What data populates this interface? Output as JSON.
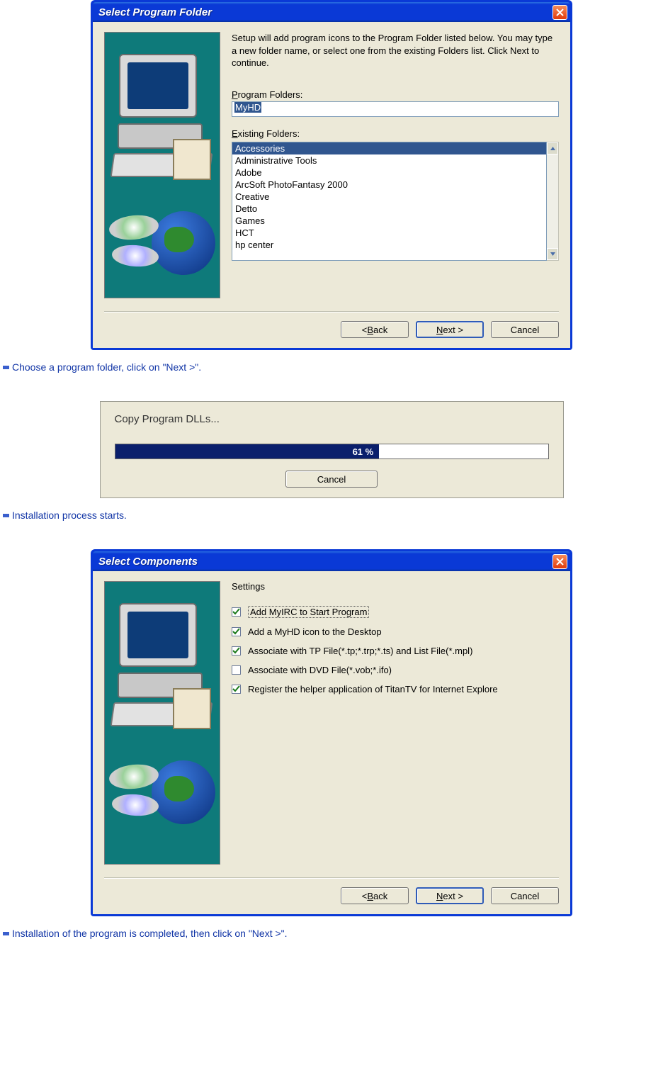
{
  "dialog1": {
    "title": "Select Program Folder",
    "description": "Setup will add program icons to the Program Folder listed below. You may type a new folder name, or select one from the existing Folders list.  Click Next to continue.",
    "program_folders_label_pre": "P",
    "program_folders_label_post": "rogram Folders:",
    "program_folder_value": "MyHD",
    "existing_folders_label_pre": "E",
    "existing_folders_label_post": "xisting Folders:",
    "existing_folders": [
      "Accessories",
      "Administrative Tools",
      "Adobe",
      "ArcSoft PhotoFantasy 2000",
      "Creative",
      "Detto",
      "Games",
      "HCT",
      "hp center"
    ],
    "selected_folder_index": 0,
    "buttons": {
      "back_pre": "< ",
      "back_ul": "B",
      "back_post": "ack",
      "next_ul": "N",
      "next_post": "ext >",
      "cancel": "Cancel"
    }
  },
  "caption1": "Choose a program folder, click on \"Next >\".",
  "dialog2": {
    "title": "Copy Program DLLs...",
    "percent": 61,
    "percent_label": "61 %",
    "cancel": "Cancel"
  },
  "caption2": "Installation process starts.",
  "dialog3": {
    "title": "Select Components",
    "settings_label": "Settings",
    "checks": [
      {
        "label": "Add MyIRC to Start Program",
        "checked": true,
        "focused": true
      },
      {
        "label": "Add a MyHD icon to the Desktop",
        "checked": true,
        "focused": false
      },
      {
        "label": "Associate with TP File(*.tp;*.trp;*.ts) and List File(*.mpl)",
        "checked": true,
        "focused": false
      },
      {
        "label": "Associate with DVD File(*.vob;*.ifo)",
        "checked": false,
        "focused": false
      },
      {
        "label": "Register the helper application of TitanTV for Internet Explore",
        "checked": true,
        "focused": false
      }
    ],
    "buttons": {
      "back_pre": "< ",
      "back_ul": "B",
      "back_post": "ack",
      "next_ul": "N",
      "next_post": "ext >",
      "cancel": "Cancel"
    }
  },
  "caption3": "Installation of the program is completed, then click on \"Next >\"."
}
